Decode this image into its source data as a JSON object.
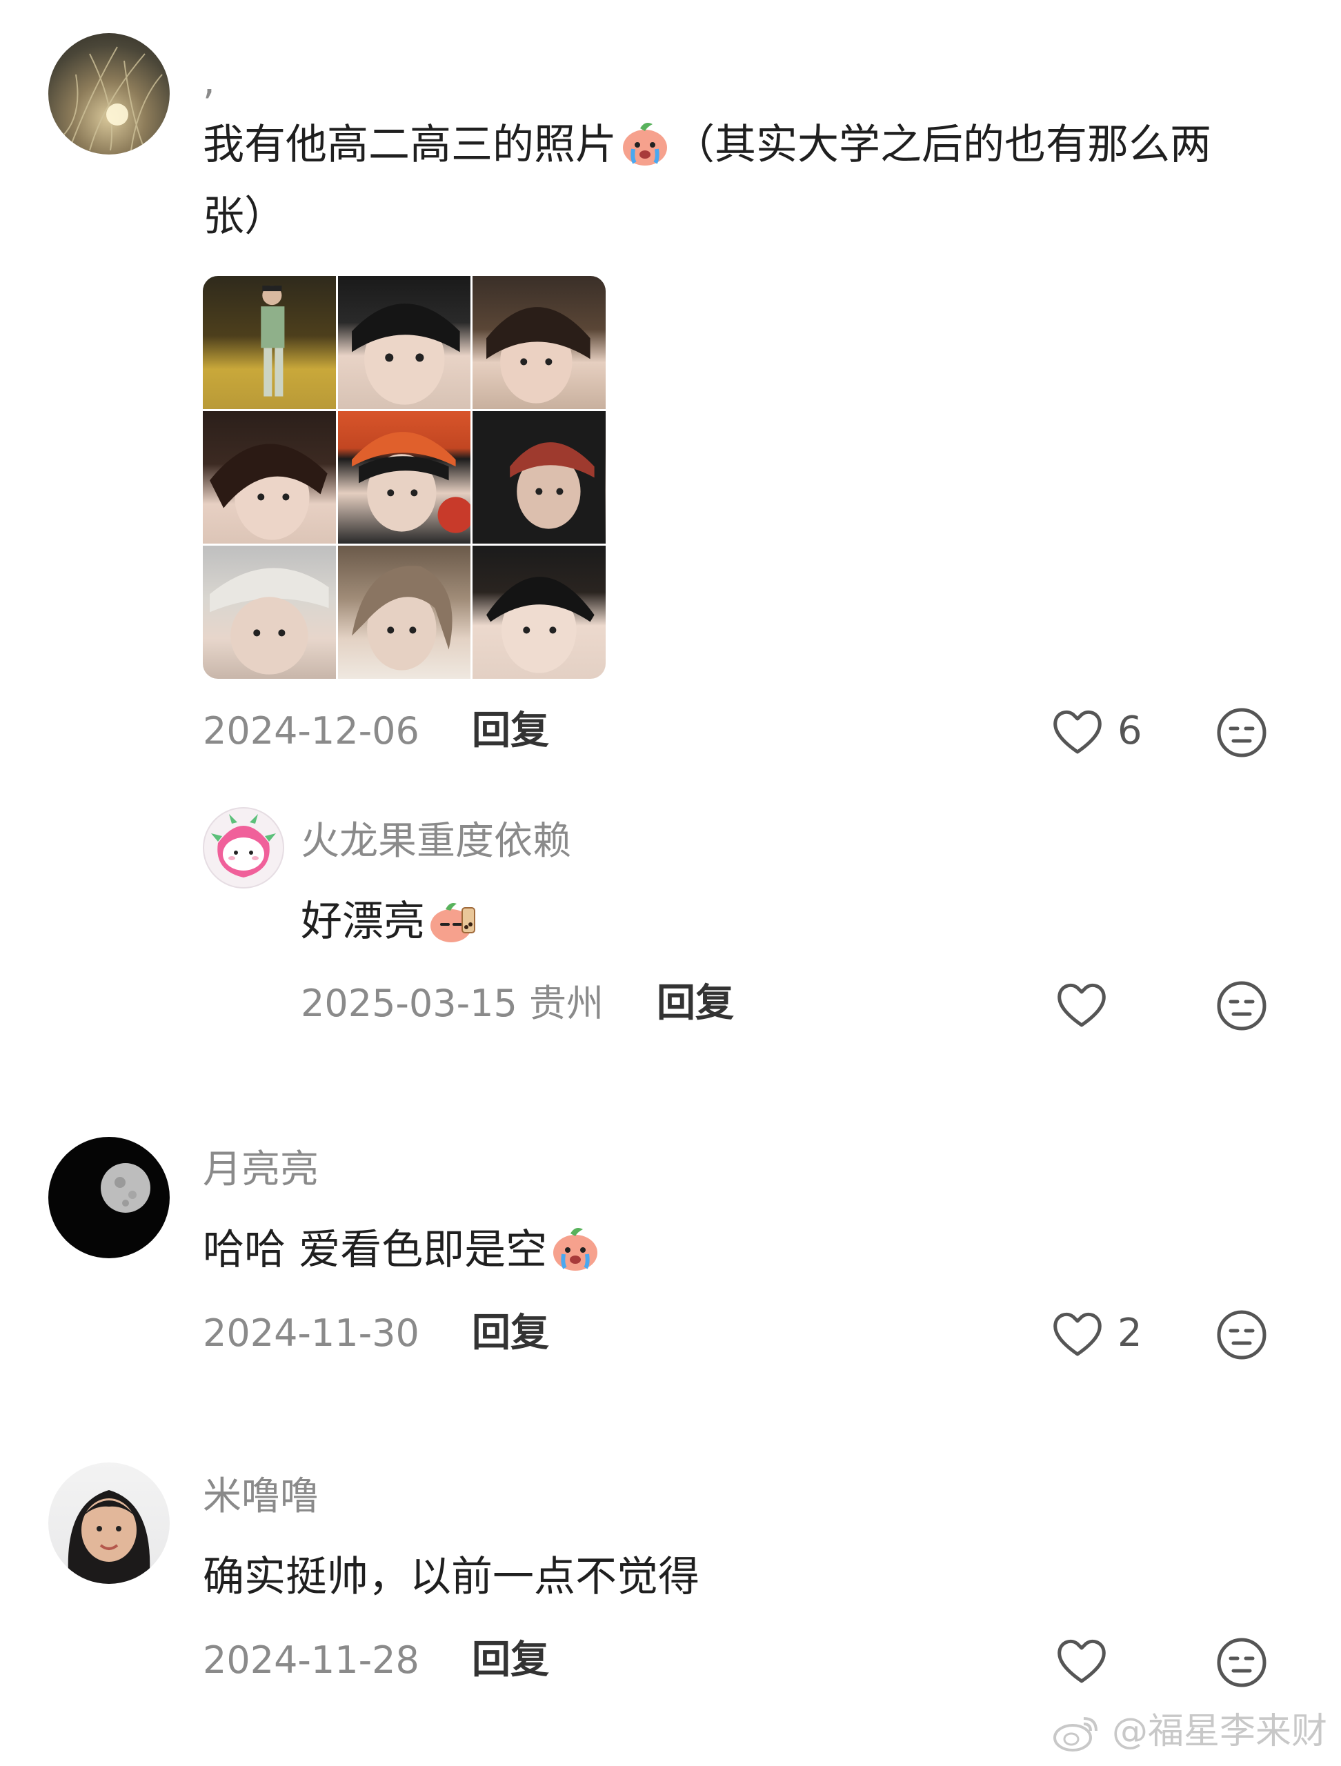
{
  "comments": [
    {
      "username": ",",
      "text": "我有他高二高三的照片",
      "text_after_emoji": "（其实大学之后的也有那么两张）",
      "date": "2024-12-06",
      "reply_label": "回复",
      "like_count": "6",
      "has_image_grid": true,
      "image_count": 9
    },
    {
      "username": "月亮亮",
      "text": "哈哈 爱看色即是空",
      "date": "2024-11-30",
      "reply_label": "回复",
      "like_count": "2"
    },
    {
      "username": "米噜噜",
      "text": "确实挺帅，以前一点不觉得",
      "date": "2024-11-28",
      "reply_label": "回复",
      "like_count": ""
    }
  ],
  "replies": [
    {
      "username": "火龙果重度依赖",
      "text": "好漂亮",
      "date": "2025-03-15",
      "location": "贵州",
      "reply_label": "回复",
      "like_count": ""
    }
  ],
  "watermark": "@福星李来财",
  "colors": {
    "meta_gray": "#8a8a8a",
    "text": "#1f1f1f",
    "icon_gray": "#666666",
    "emoji_peach": "#f6a18d"
  },
  "icons": [
    "heart-outline-icon",
    "neutral-face-icon",
    "crying-peach-emoji",
    "weibo-logo-icon"
  ]
}
